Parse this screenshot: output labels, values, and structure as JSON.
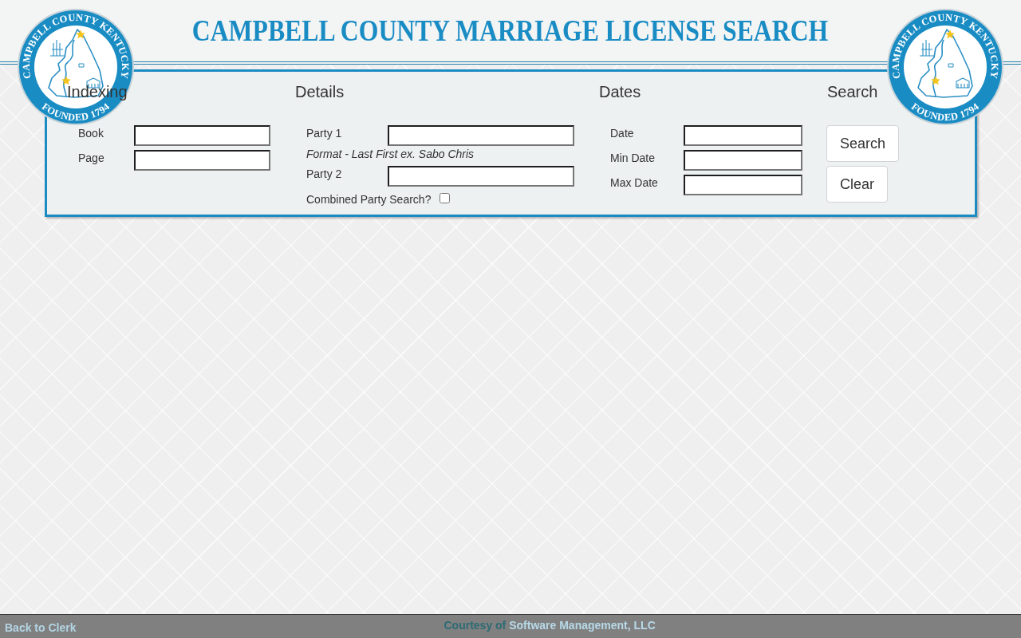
{
  "header": {
    "title": "CAMPBELL COUNTY MARRIAGE LICENSE SEARCH",
    "seals": [
      {
        "top_text": "CAMPBELL COUNTY KENTUCKY",
        "bottom_text": "FOUNDED 1794"
      },
      {
        "top_text": "CAMPBELL COUNTY KENTUCKY",
        "bottom_text": "FOUNDED 1794"
      }
    ]
  },
  "search_form": {
    "sections": [
      {
        "kind": "fields",
        "heading": "Indexing",
        "fields": [
          {
            "kind": "text",
            "label": "Book"
          },
          {
            "kind": "text",
            "label": "Page"
          }
        ]
      },
      {
        "kind": "fields",
        "heading": "Details",
        "fields": [
          {
            "kind": "text",
            "label": "Party 1"
          },
          {
            "kind": "hint",
            "text": "Format - Last First ex. Sabo Chris"
          },
          {
            "kind": "text",
            "label": "Party 2"
          },
          {
            "kind": "checkbox",
            "label": "Combined Party Search?",
            "checked": false
          }
        ]
      },
      {
        "kind": "fields",
        "heading": "Dates",
        "fields": [
          {
            "kind": "text",
            "label": "Date"
          },
          {
            "kind": "text",
            "label": "Min Date"
          },
          {
            "kind": "text",
            "label": "Max Date"
          }
        ]
      },
      {
        "kind": "buttons",
        "heading": "Search",
        "buttons": [
          "Search",
          "Clear"
        ]
      }
    ]
  },
  "footer": {
    "back_link": "Back to Clerk",
    "credit_prefix": "Courtesy of",
    "credit_link": "Software Management, LLC"
  }
}
